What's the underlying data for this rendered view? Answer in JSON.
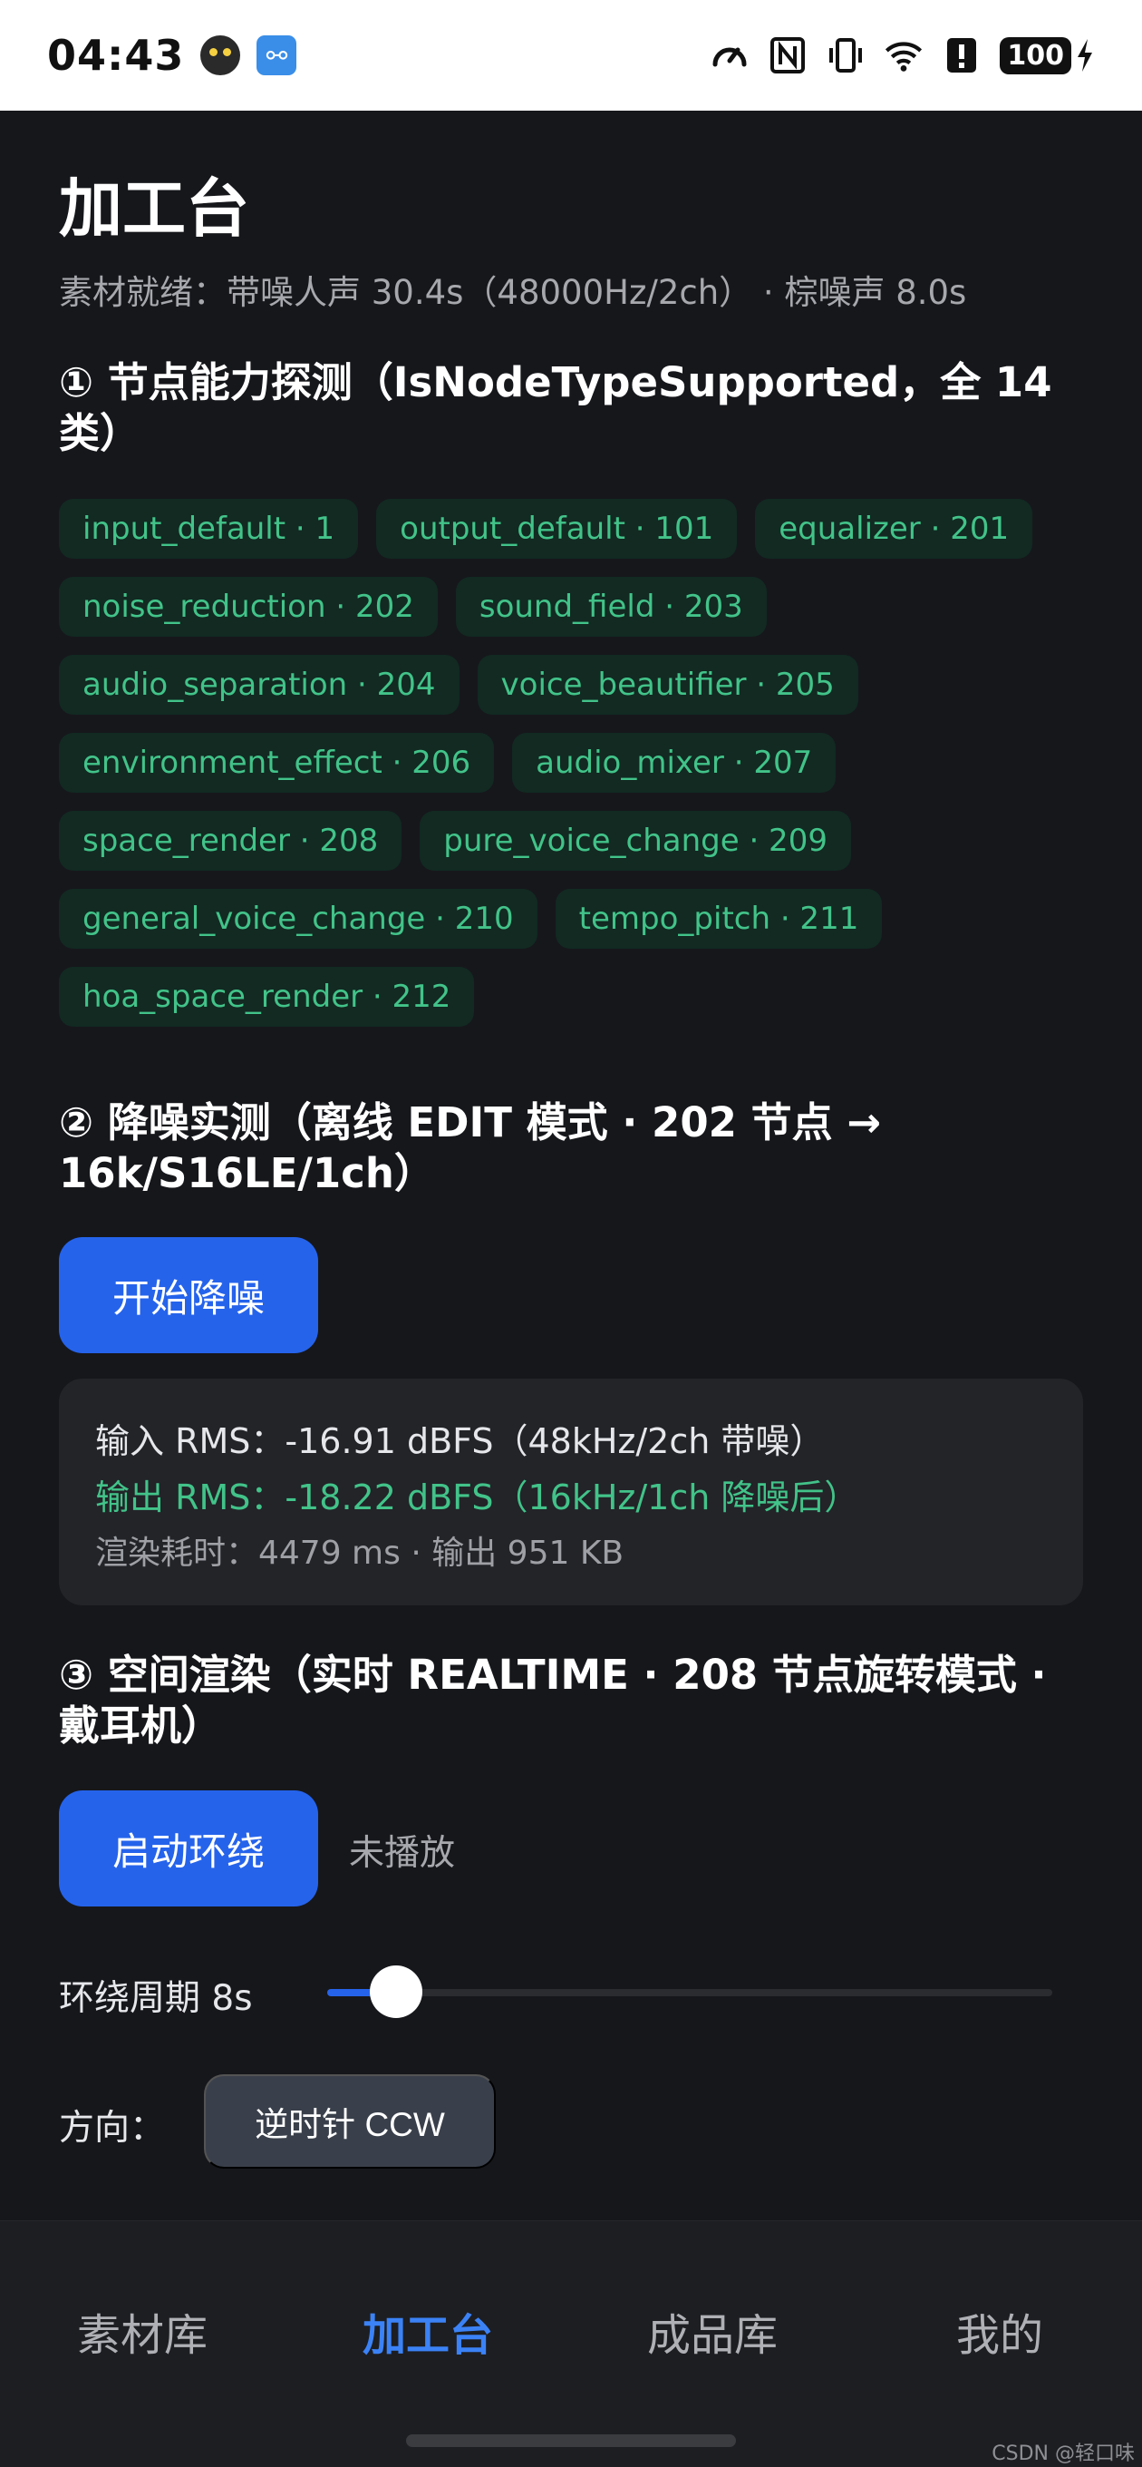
{
  "status_bar": {
    "time": "04:43",
    "notification_icons": [
      "cat-app-icon",
      "usb-icon"
    ],
    "system_icons": [
      "speedometer-icon",
      "nfc-icon",
      "vibrate-icon",
      "wifi-icon",
      "alert-icon"
    ],
    "battery": "100"
  },
  "page": {
    "title": "加工台",
    "subtitle": "素材就绪：带噪人声 30.4s（48000Hz/2ch） · 棕噪声 8.0s"
  },
  "section1": {
    "title": "① 节点能力探测（IsNodeTypeSupported，全 14 类）",
    "chips": [
      "input_default · 1",
      "output_default · 101",
      "equalizer · 201",
      "noise_reduction · 202",
      "sound_field · 203",
      "audio_separation · 204",
      "voice_beautifier · 205",
      "environment_effect · 206",
      "audio_mixer · 207",
      "space_render · 208",
      "pure_voice_change · 209",
      "general_voice_change · 210",
      "tempo_pitch · 211",
      "hoa_space_render · 212"
    ]
  },
  "section2": {
    "title": "② 降噪实测（离线 EDIT 模式 · 202 节点 → 16k/S16LE/1ch）",
    "button": "开始降噪",
    "result": {
      "input": "输入 RMS：-16.91 dBFS（48kHz/2ch 带噪）",
      "output": "输出 RMS：-18.22 dBFS（16kHz/1ch 降噪后）",
      "meta": "渲染耗时：4479 ms · 输出 951 KB"
    }
  },
  "section3": {
    "title": "③ 空间渲染（实时 REALTIME · 208 节点旋转模式 · 戴耳机）",
    "button": "启动环绕",
    "status": "未播放",
    "slider_label": "环绕周期 8s",
    "slider_fraction": 0.095,
    "direction_label": "方向：",
    "direction_button": "逆时针 CCW"
  },
  "bottom_nav": {
    "items": [
      "素材库",
      "加工台",
      "成品库",
      "我的"
    ],
    "active_index": 1
  },
  "watermark": "CSDN @轻口味",
  "colors": {
    "accent": "#2563eb",
    "success": "#42c389",
    "background": "#16171b"
  }
}
